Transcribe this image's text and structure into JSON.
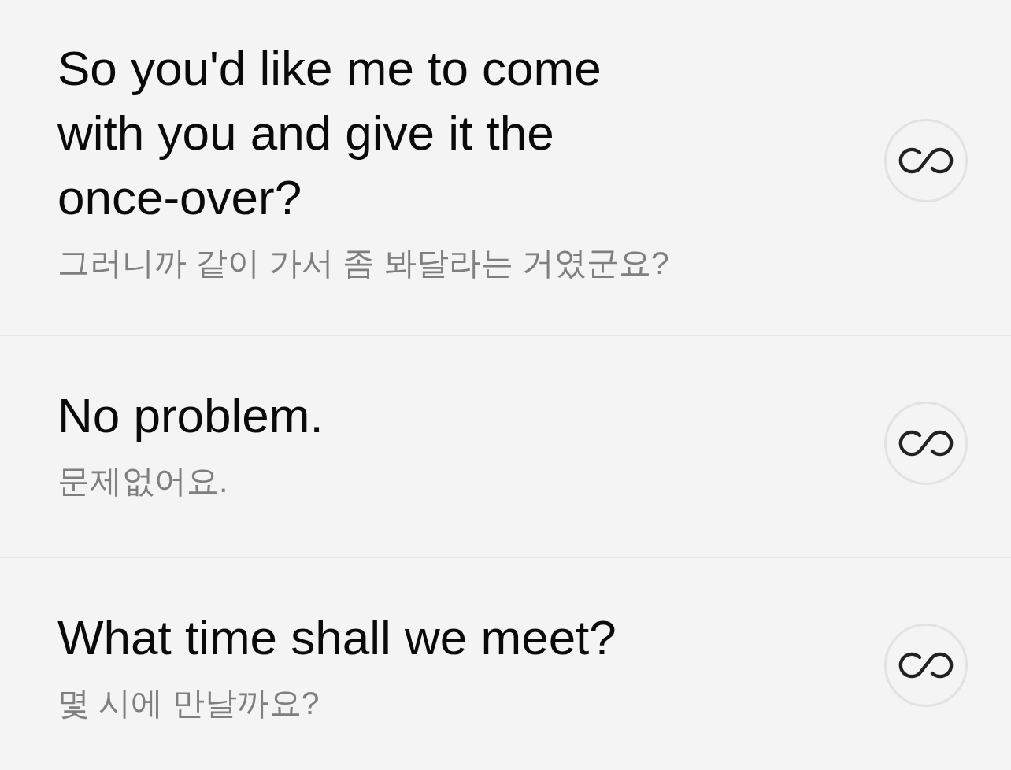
{
  "sentences": [
    {
      "text": "So you'd like me to come with you and give it the once-over?",
      "translation": "그러니까 같이 가서 좀 봐달라는 거였군요?"
    },
    {
      "text": "No problem.",
      "translation": "문제없어요."
    },
    {
      "text": "What time shall we meet?",
      "translation": "몇 시에 만날까요?"
    }
  ]
}
